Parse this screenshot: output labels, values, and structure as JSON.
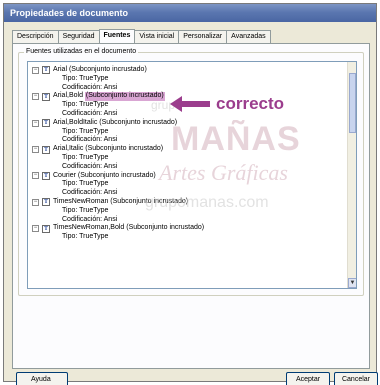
{
  "window": {
    "title": "Propiedades de documento"
  },
  "tabs": [
    {
      "label": "Descripción",
      "active": false
    },
    {
      "label": "Seguridad",
      "active": false
    },
    {
      "label": "Fuentes",
      "active": true
    },
    {
      "label": "Vista inicial",
      "active": false
    },
    {
      "label": "Personalizar",
      "active": false
    },
    {
      "label": "Avanzadas",
      "active": false
    }
  ],
  "group": {
    "legend": "Fuentes utilizadas en el documento"
  },
  "fonts": [
    {
      "name_plain": "Arial (Subconjunto incrustado)",
      "name_prefix": "Arial",
      "highlighted": "",
      "type": "Tipo: TrueType",
      "encoding": "Codificación: Ansi"
    },
    {
      "name_plain": "",
      "name_prefix": "Arial,Bold",
      "highlighted": "(Subconjunto incrustado)",
      "type": "Tipo: TrueType",
      "encoding": "Codificación: Ansi"
    },
    {
      "name_plain": "Arial,BoldItalic (Subconjunto incrustado)",
      "name_prefix": "",
      "highlighted": "",
      "type": "Tipo: TrueType",
      "encoding": "Codificación: Ansi"
    },
    {
      "name_plain": "Arial,Italic (Subconjunto incrustado)",
      "name_prefix": "",
      "highlighted": "",
      "type": "Tipo: TrueType",
      "encoding": "Codificación: Ansi"
    },
    {
      "name_plain": "Courier (Subconjunto incrustado)",
      "name_prefix": "",
      "highlighted": "",
      "type": "Tipo: TrueType",
      "encoding": "Codificación: Ansi"
    },
    {
      "name_plain": "TimesNewRoman (Subconjunto incrustado)",
      "name_prefix": "",
      "highlighted": "",
      "type": "Tipo: TrueType",
      "encoding": "Codificación: Ansi"
    },
    {
      "name_plain": "TimesNewRoman,Bold (Subconjunto incrustado)",
      "name_prefix": "",
      "highlighted": "",
      "type": "Tipo: TrueType",
      "encoding": ""
    }
  ],
  "watermark": {
    "line1": "grupo",
    "line2": "MAÑAS",
    "line3": "Artes Gráficas",
    "line4": "grupomanas.com"
  },
  "annotation": {
    "text": "correcto",
    "color": "#9b3d8d"
  },
  "buttons": {
    "help": "Ayuda",
    "ok": "Aceptar",
    "cancel": "Cancelar"
  },
  "icons": {
    "expander": "minus-box-icon",
    "font": "font-type-icon"
  }
}
